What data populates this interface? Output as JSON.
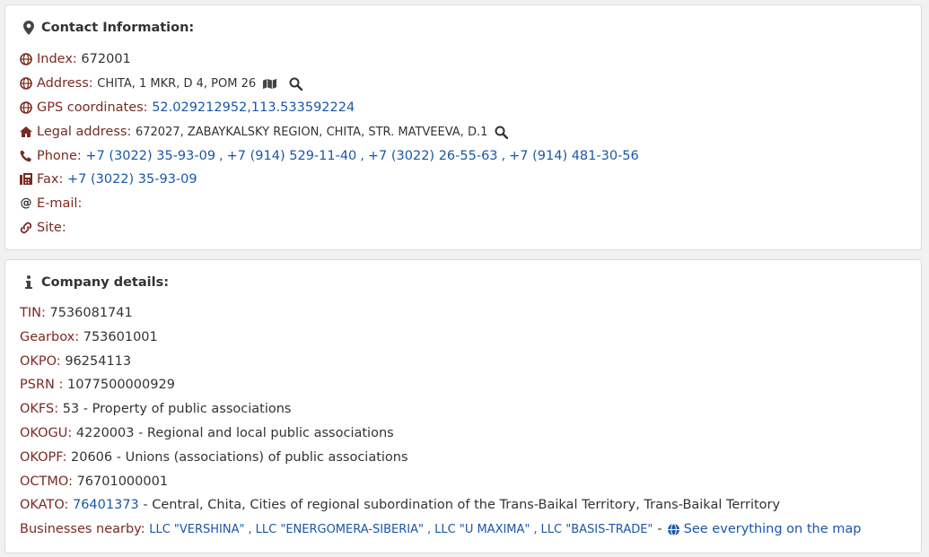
{
  "contact": {
    "title": "Contact Information:",
    "index_label": "Index:",
    "index_value": "672001",
    "address_label": "Address:",
    "address_value": "CHITA, 1 MKR, D 4, POM 26",
    "gps_label": "GPS coordinates:",
    "gps_value": "52.029212952,113.533592224",
    "legal_label": "Legal address:",
    "legal_value": "672027, ZABAYKALSKY REGION, CHITA, STR. MATVEEVA, D.1",
    "phone_label": "Phone:",
    "phones": [
      "+7 (3022) 35-93-09",
      "+7 (914) 529-11-40",
      "+7 (3022) 26-55-63",
      "+7 (914) 481-30-56"
    ],
    "phone_sep": ",",
    "fax_label": "Fax:",
    "fax_value": "+7 (3022) 35-93-09",
    "email_label": "E-mail:",
    "site_label": "Site:"
  },
  "details": {
    "title": "Company details:",
    "tin_label": "TIN:",
    "tin_value": "7536081741",
    "gearbox_label": "Gearbox:",
    "gearbox_value": "753601001",
    "okpo_label": "OKPO:",
    "okpo_value": "96254113",
    "psrn_label": "PSRN :",
    "psrn_value": "1077500000929",
    "okfs_label": "OKFS:",
    "okfs_value": "53 - Property of public associations",
    "okogu_label": "OKOGU:",
    "okogu_value": "4220003 - Regional and local public associations",
    "okopf_label": "OKOPF:",
    "okopf_value": "20606 - Unions (associations) of public associations",
    "octmo_label": "OCTMO:",
    "octmo_value": "76701000001",
    "okato_label": "OKATO:",
    "okato_code": "76401373",
    "okato_desc": "- Central, Chita, Cities of regional subordination of the Trans-Baikal Territory, Trans-Baikal Territory",
    "nearby_label": "Businesses nearby:",
    "nearby": [
      "LLC \"VERSHINA\"",
      "LLC \"ENERGOMERA-SIBERIA\"",
      "LLC \"U MAXIMA\"",
      "LLC \"BASIS-TRADE\""
    ],
    "nearby_sep": ",",
    "nearby_dash": "-",
    "map_link": "See everything on the map"
  },
  "colors": {
    "label": "#7a2a22",
    "link": "#1a56a8",
    "text": "#333333"
  },
  "icons": [
    "map-marker-icon",
    "globe-icon",
    "map-icon",
    "search-icon",
    "home-icon",
    "phone-icon",
    "fax-icon",
    "at-icon",
    "link-icon",
    "info-icon"
  ]
}
